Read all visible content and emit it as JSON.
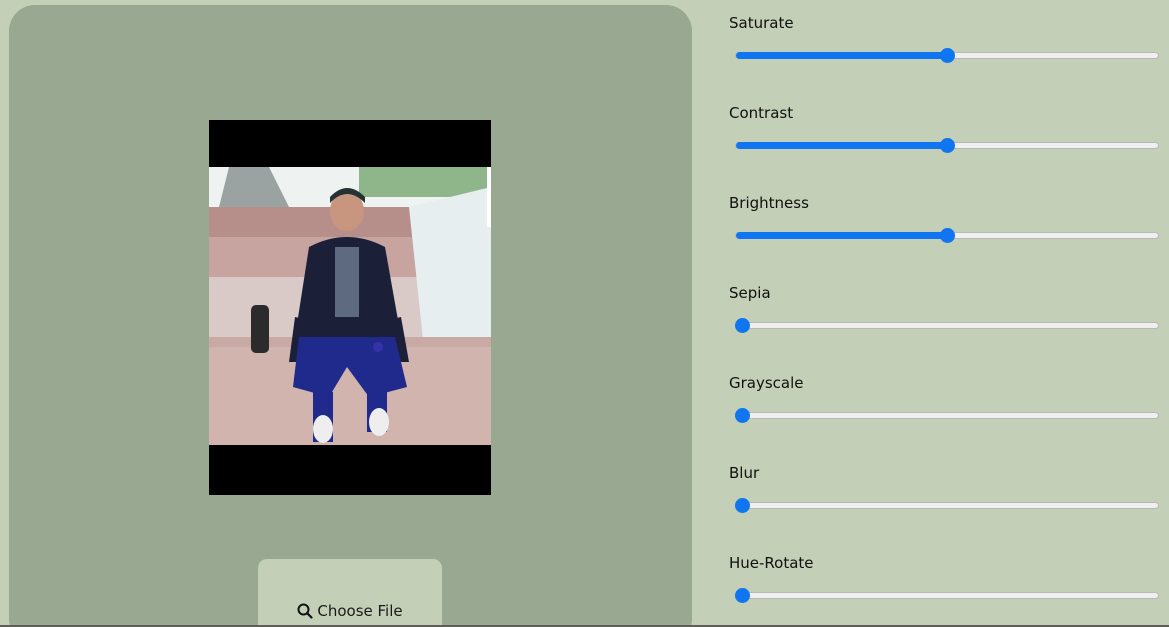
{
  "upload": {
    "button_label": "Choose File",
    "icon": "search-icon"
  },
  "photo": {
    "description_icon": "photo-image"
  },
  "filters": [
    {
      "label": "Saturate",
      "value": 0.5
    },
    {
      "label": "Contrast",
      "value": 0.5
    },
    {
      "label": "Brightness",
      "value": 0.5
    },
    {
      "label": "Sepia",
      "value": 0.0
    },
    {
      "label": "Grayscale",
      "value": 0.0
    },
    {
      "label": "Blur",
      "value": 0.0
    },
    {
      "label": "Hue-Rotate",
      "value": 0.0
    }
  ],
  "colors": {
    "page_background": "#c3cfb6",
    "preview_panel": "#99a890",
    "slider_accent": "#0f75f0"
  }
}
